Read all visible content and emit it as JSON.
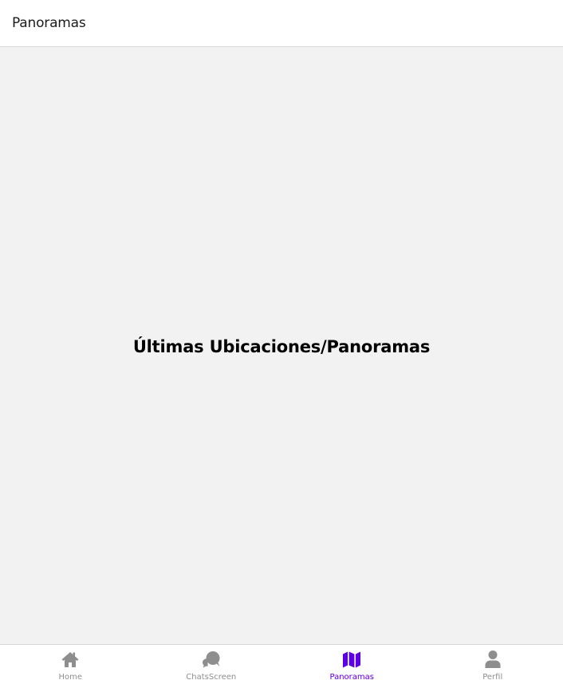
{
  "header": {
    "title": "Panoramas"
  },
  "main": {
    "title": "Últimas Ubicaciones/Panoramas"
  },
  "tabbar": {
    "active_color": "#5b00e0",
    "inactive_color": "#8e8e8f",
    "items": [
      {
        "label": "Home",
        "icon": "home-icon",
        "active": false
      },
      {
        "label": "ChatsScreen",
        "icon": "chat-bubbles-icon",
        "active": false
      },
      {
        "label": "Panoramas",
        "icon": "map-icon",
        "active": true
      },
      {
        "label": "Perfil",
        "icon": "person-icon",
        "active": false
      }
    ]
  }
}
